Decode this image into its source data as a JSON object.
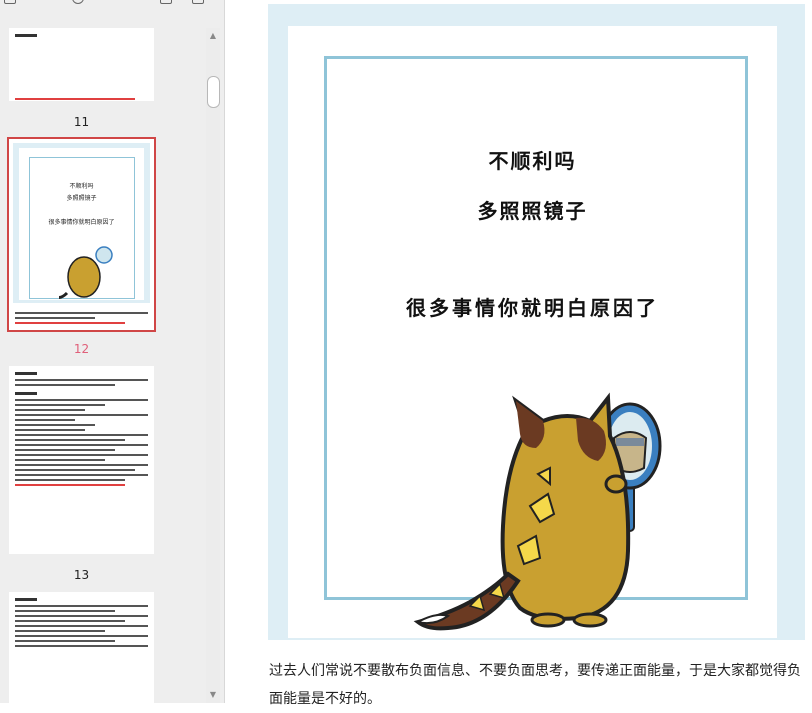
{
  "sidebar": {
    "pages": [
      {
        "number": "11",
        "active": false
      },
      {
        "number": "12",
        "active": true
      },
      {
        "number": "13",
        "active": false
      }
    ],
    "thumb12_lines": [
      "不顺利吗",
      "多照照镜子",
      "很多事情你就明白原因了"
    ]
  },
  "page": {
    "title_line1": "不顺利吗",
    "title_line2": "多照照镜子",
    "title_line3": "很多事情你就明白原因了",
    "body_text": "过去人们常说不要散布负面信息、不要负面思考，要传递正面能量，于是大家都觉得负面能量是不好的。"
  },
  "colors": {
    "frame_bg": "#deeef5",
    "border": "#8fc4d8",
    "active_label": "#e0607a",
    "active_thumb_border": "#d04646"
  }
}
